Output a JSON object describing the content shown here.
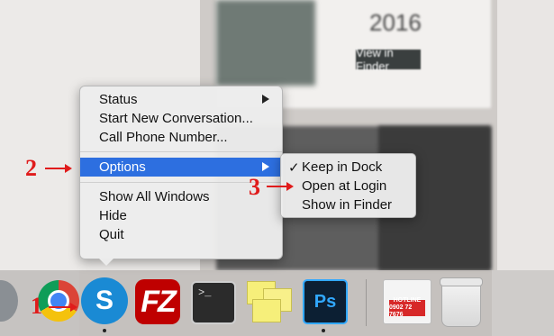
{
  "context_menu": {
    "items": [
      {
        "label": "Status",
        "submenu": true
      },
      {
        "label": "Start New Conversation...",
        "submenu": false
      },
      {
        "label": "Call Phone Number...",
        "submenu": false
      },
      {
        "label": "Options",
        "submenu": true,
        "highlighted": true
      },
      {
        "label": "Show All Windows",
        "submenu": false
      },
      {
        "label": "Hide",
        "submenu": false
      },
      {
        "label": "Quit",
        "submenu": false
      }
    ],
    "highlight_color": "#2d6fe0"
  },
  "options_submenu": {
    "items": [
      {
        "label": "Keep in Dock",
        "checked": true,
        "check": "✓"
      },
      {
        "label": "Open at Login",
        "checked": false
      },
      {
        "label": "Show in Finder",
        "checked": false
      }
    ]
  },
  "dock": {
    "apps": [
      {
        "name": "Chrome",
        "icon": "chrome-icon"
      },
      {
        "name": "Skype",
        "icon": "skype-icon",
        "glyph": "S",
        "running": true
      },
      {
        "name": "FileZilla",
        "icon": "filezilla-icon",
        "glyph": "FZ"
      },
      {
        "name": "Terminal",
        "icon": "terminal-icon",
        "glyph": ">_"
      },
      {
        "name": "Stickies",
        "icon": "stickies-icon"
      },
      {
        "name": "Photoshop",
        "icon": "photoshop-icon",
        "glyph": "Ps",
        "running": true
      },
      {
        "name": "Hotline",
        "icon": "hotline-icon",
        "lines": [
          "HOTLINE",
          "0902 72 7676"
        ]
      },
      {
        "name": "Trash",
        "icon": "trash-icon"
      }
    ]
  },
  "annotations": {
    "step1": "1",
    "step2": "2",
    "step3": "3",
    "color": "#e01b1b"
  },
  "background": {
    "card_year": "2016",
    "card_button": "View in Finder"
  }
}
